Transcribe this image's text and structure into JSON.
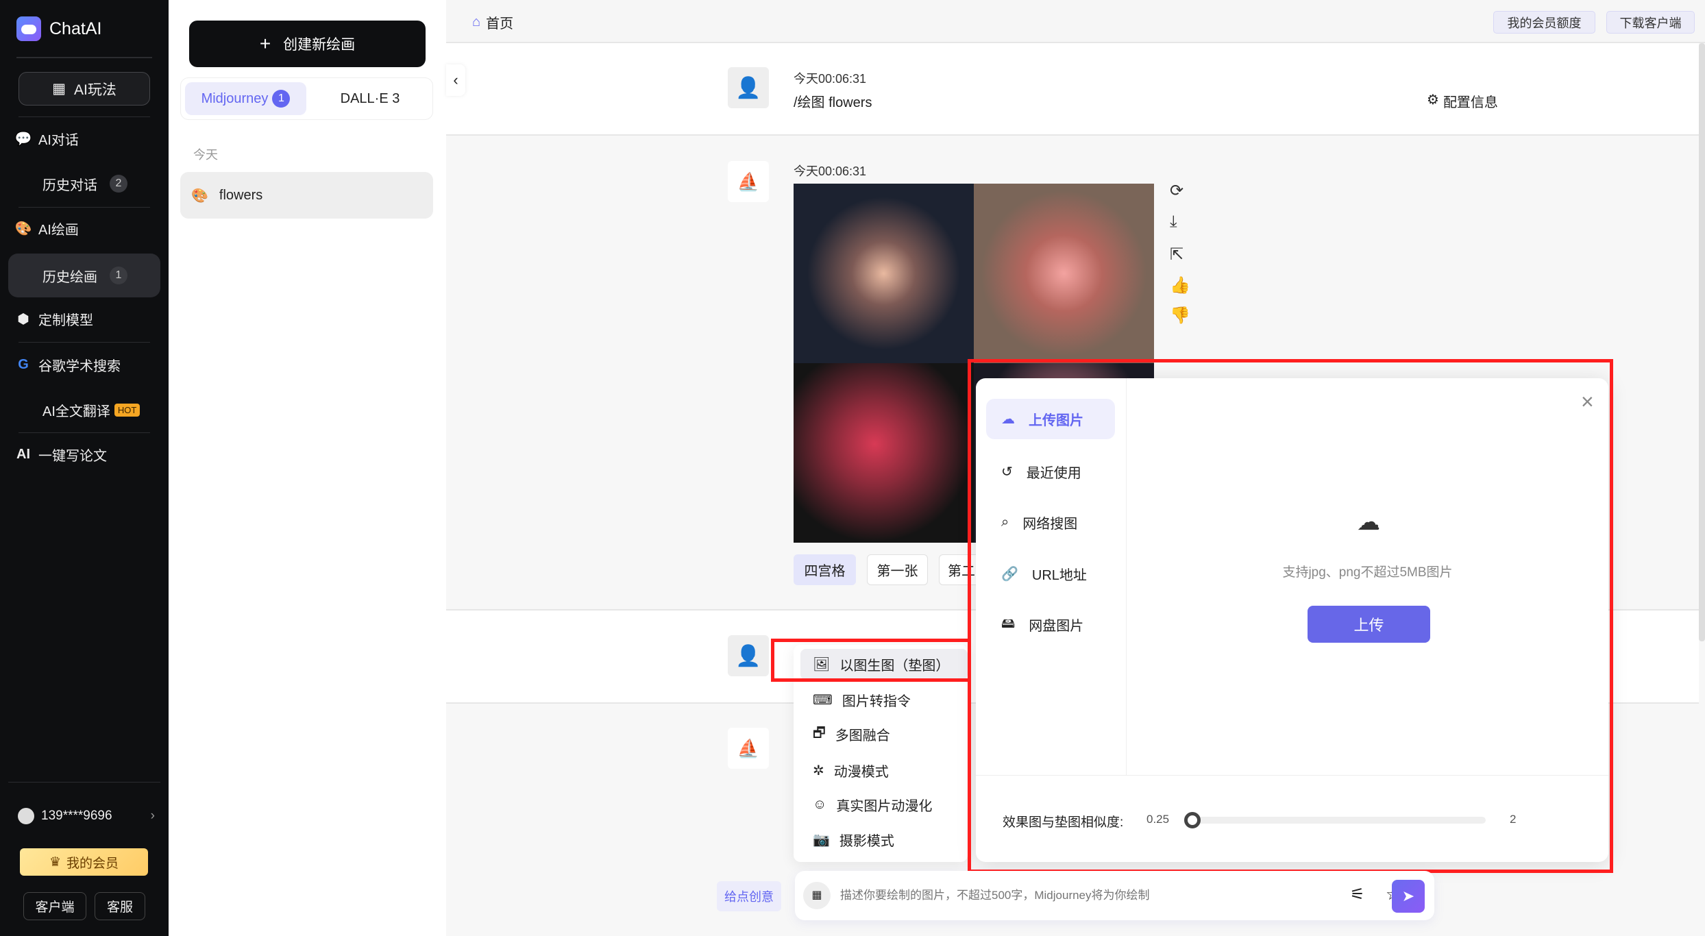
{
  "sidebar": {
    "brand": "ChatAI",
    "ai_play": "AI玩法",
    "items": [
      {
        "label": "AI对话",
        "icon": "chat-icon"
      },
      {
        "label": "历史对话",
        "count": "2"
      },
      {
        "label": "AI绘画",
        "icon": "palette-icon"
      },
      {
        "label": "历史绘画",
        "count": "1",
        "active": true
      },
      {
        "label": "定制模型",
        "icon": "ai-hex-icon"
      },
      {
        "label": "谷歌学术搜索",
        "icon": "google-icon"
      },
      {
        "label": "AI全文翻译",
        "badge": "HOT"
      },
      {
        "label": "一键写论文",
        "icon": "ai-write-icon"
      }
    ],
    "user": "139****9696",
    "member": "我的会员",
    "client": "客户端",
    "service": "客服"
  },
  "panel": {
    "create": "创建新绘画",
    "tabs": [
      {
        "label": "Midjourney",
        "count": "1",
        "active": true
      },
      {
        "label": "DALL·E 3"
      }
    ],
    "group": "今天",
    "history": [
      {
        "label": "flowers"
      }
    ]
  },
  "topbar": {
    "home": "首页",
    "quota": "我的会员额度",
    "download": "下载客户端"
  },
  "messages": {
    "m1_time": "今天00:06:31",
    "m1_text": "/绘图 flowers",
    "config": "配置信息",
    "m2_time": "今天00:06:31",
    "options": [
      "四宫格",
      "第一张",
      "第二"
    ]
  },
  "menu": {
    "items": [
      "以图生图（垫图）",
      "图片转指令",
      "多图融合",
      "动漫模式",
      "真实图片动漫化",
      "摄影模式"
    ]
  },
  "modal": {
    "nav": [
      "上传图片",
      "最近使用",
      "网络搜图",
      "URL地址",
      "网盘图片"
    ],
    "hint": "支持jpg、png不超过5MB图片",
    "upload": "上传",
    "similarity_label": "效果图与垫图相似度:",
    "min": "0.25",
    "max": "2",
    "value": 0.25
  },
  "input": {
    "idea": "给点创意",
    "placeholder": "描述你要绘制的图片，不超过500字，Midjourney将为你绘制"
  },
  "colors": {
    "accent": "#6366f1",
    "sidebar": "#0e0f11",
    "highlight": "#ff1e1e"
  }
}
